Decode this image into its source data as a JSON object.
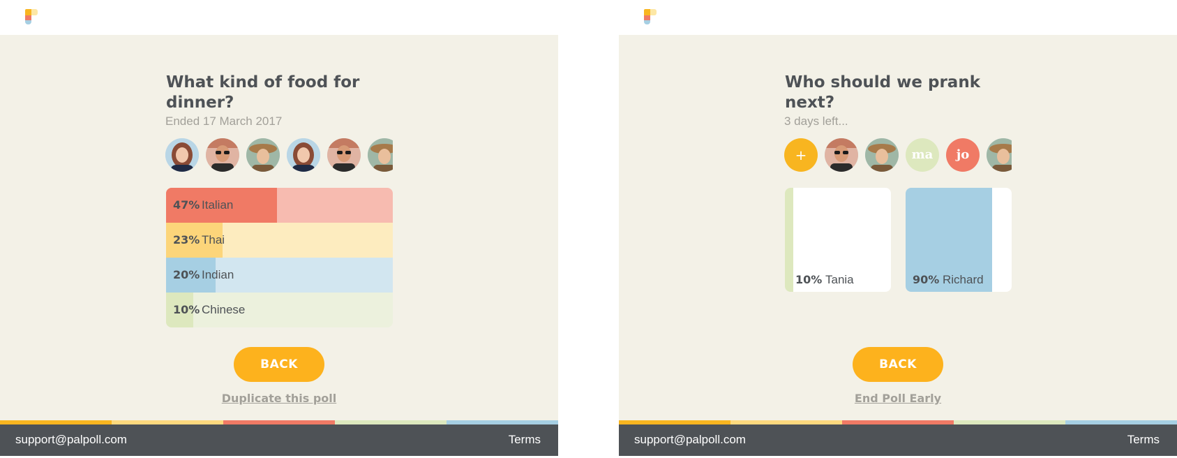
{
  "colors": {
    "canvas_bg": "#f3f1e7",
    "accent_orange": "#fdb21d",
    "red": "#f07a65",
    "red_light": "#f7bbb0",
    "yellow": "#fcd57a",
    "yellow_light": "#fdecbf",
    "blue": "#a6cfe3",
    "blue_light": "#d2e6f0",
    "green": "#dde8be",
    "green_light": "#ecf1dd",
    "footer_bg": "#4e5256"
  },
  "left_poll": {
    "title": "What kind of food for dinner?",
    "status": "Ended 17 March 2017",
    "avatars": [
      {
        "kind": "photo",
        "icon": "woman-avatar-icon"
      },
      {
        "kind": "photo",
        "icon": "man-sunglasses-avatar-icon"
      },
      {
        "kind": "photo",
        "icon": "woman-hat-avatar-icon"
      },
      {
        "kind": "photo",
        "icon": "woman-avatar-icon"
      },
      {
        "kind": "photo",
        "icon": "man-sunglasses-avatar-icon"
      },
      {
        "kind": "photo",
        "icon": "woman-hat-avatar-icon"
      }
    ],
    "results": [
      {
        "pct_label": "47%",
        "value": 47,
        "label": "Italian",
        "color": "#f07a65",
        "track": "#f7bbb0"
      },
      {
        "pct_label": "23%",
        "value": 23,
        "label": "Thai",
        "color": "#fcd57a",
        "track": "#fdecbf"
      },
      {
        "pct_label": "20%",
        "value": 20,
        "label": "Indian",
        "color": "#a6cfe3",
        "track": "#d2e6f0"
      },
      {
        "pct_label": "10%",
        "value": 10,
        "label": "Chinese",
        "color": "#dde8be",
        "track": "#ecf1dd"
      }
    ],
    "button_label": "BACK",
    "secondary_link": "Duplicate this poll"
  },
  "right_poll": {
    "title": "Who should we prank next?",
    "status": "3 days left...",
    "avatars": [
      {
        "kind": "add",
        "text": "+",
        "icon": "plus-icon"
      },
      {
        "kind": "photo",
        "icon": "man-sunglasses-avatar-icon"
      },
      {
        "kind": "photo",
        "icon": "woman-hat-avatar-icon"
      },
      {
        "kind": "initials",
        "text": "ma",
        "color": "#dde8be"
      },
      {
        "kind": "initials",
        "text": "jo",
        "color": "#f07a65"
      },
      {
        "kind": "photo",
        "icon": "woman-hat-avatar-icon"
      }
    ],
    "results": [
      {
        "pct_label": "10%",
        "value": 10,
        "label": "Tania",
        "color": "#dde8be"
      },
      {
        "pct_label": "90%",
        "value": 90,
        "label": "Richard",
        "color": "#a6cfe3"
      }
    ],
    "button_label": "BACK",
    "secondary_link": "End Poll Early"
  },
  "footer": {
    "email": "support@palpoll.com",
    "terms": "Terms"
  }
}
